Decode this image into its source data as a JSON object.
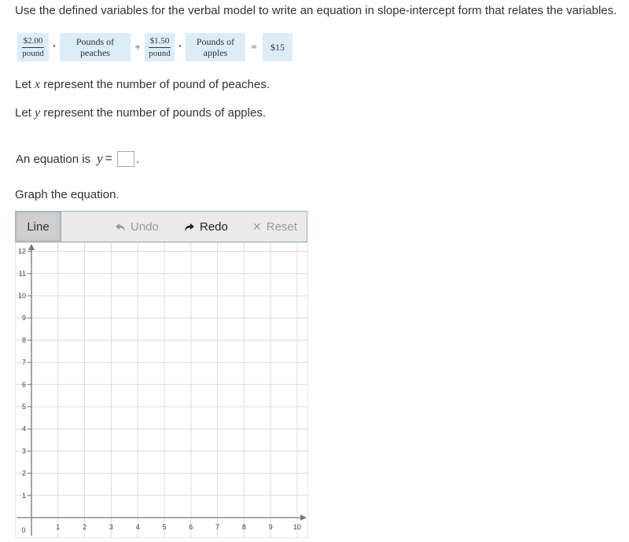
{
  "prompt": "Use the defined variables for the verbal model to write an equation in slope-intercept form that relates the variables.",
  "verbal_model": {
    "term1_rate_num": "$2.00",
    "term1_rate_den": "pound",
    "term1_var_line1": "Pounds of",
    "term1_var_line2": "peaches",
    "plus": "+",
    "term2_rate_num": "$1.50",
    "term2_rate_den": "pound",
    "term2_var_line1": "Pounds of",
    "term2_var_line2": "apples",
    "equals": "=",
    "total": "$15",
    "dot": "·"
  },
  "definitions": {
    "x_prefix": "Let ",
    "x_var": "x",
    "x_suffix": " represent the number of pound of peaches.",
    "y_prefix": "Let ",
    "y_var": "y",
    "y_suffix": " represent the number of pounds of apples."
  },
  "equation": {
    "label": "An equation is",
    "var": "y",
    "sign": "=",
    "answer_value": "",
    "period": "."
  },
  "graph_prompt": "Graph the equation.",
  "toolbar": {
    "line_label": "Line",
    "undo_label": "Undo",
    "redo_label": "Redo",
    "reset_label": "Reset",
    "undo_icon": "undo-arrow-icon",
    "redo_icon": "redo-arrow-icon",
    "reset_icon": "x-icon"
  },
  "chart_data": {
    "type": "line",
    "title": "",
    "xlabel": "",
    "ylabel": "",
    "xlim": [
      0,
      10
    ],
    "ylim": [
      0,
      12
    ],
    "x_ticks": [
      "1",
      "2",
      "3",
      "4",
      "5",
      "6",
      "7",
      "8",
      "9",
      "10"
    ],
    "y_ticks": [
      "1",
      "2",
      "3",
      "4",
      "5",
      "6",
      "7",
      "8",
      "9",
      "10",
      "11",
      "12"
    ],
    "origin_label": "0",
    "grid": true,
    "series": []
  }
}
